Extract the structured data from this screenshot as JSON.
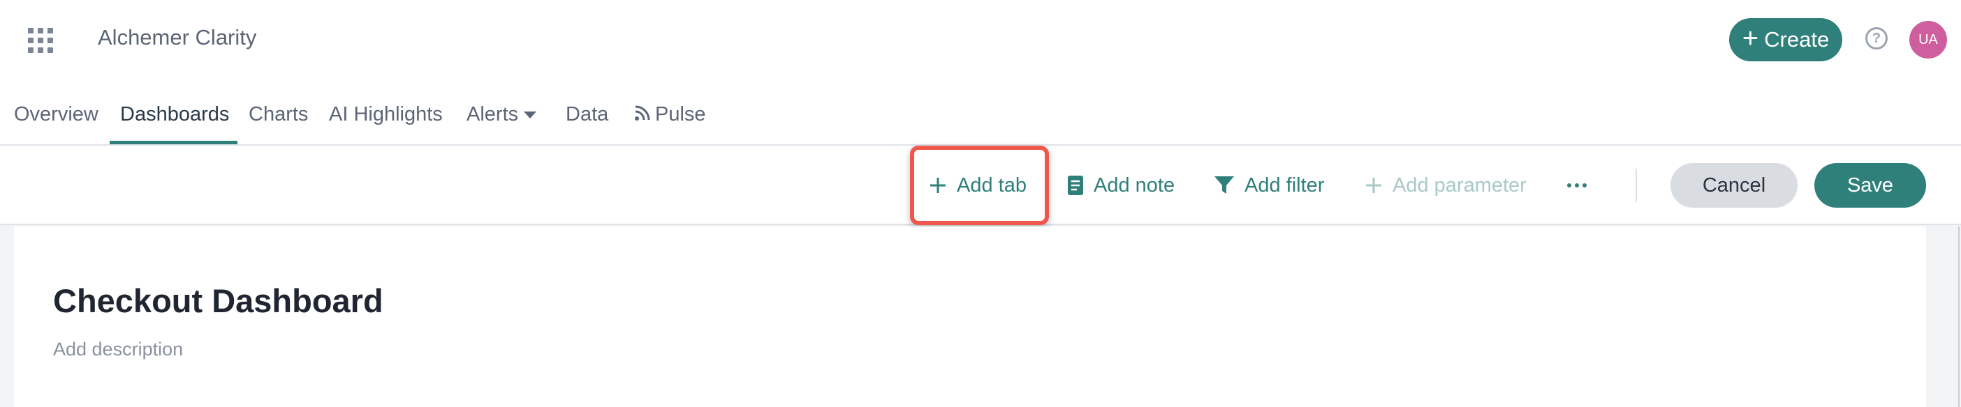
{
  "header": {
    "app_title": "Alchemer Clarity",
    "create_label": "Create",
    "avatar_initials": "UA",
    "help_symbol": "?"
  },
  "nav": {
    "items": [
      {
        "label": "Overview"
      },
      {
        "label": "Dashboards",
        "active": true
      },
      {
        "label": "Charts"
      },
      {
        "label": "AI Highlights"
      },
      {
        "label": "Alerts"
      },
      {
        "label": "Data"
      },
      {
        "label": "Pulse"
      }
    ]
  },
  "toolbar": {
    "add_tab": "Add tab",
    "add_note": "Add note",
    "add_filter": "Add filter",
    "add_parameter": "Add parameter",
    "cancel": "Cancel",
    "save": "Save"
  },
  "dashboard": {
    "title": "Checkout Dashboard",
    "description_placeholder": "Add description"
  },
  "colors": {
    "accent": "#2f7f7a",
    "highlight": "#f0564a",
    "avatar": "#cf5e9e"
  },
  "icons": [
    "apps-grid-icon",
    "plus-icon",
    "help-icon",
    "chevron-down-icon",
    "rss-icon",
    "note-icon",
    "filter-icon",
    "more-icon"
  ]
}
